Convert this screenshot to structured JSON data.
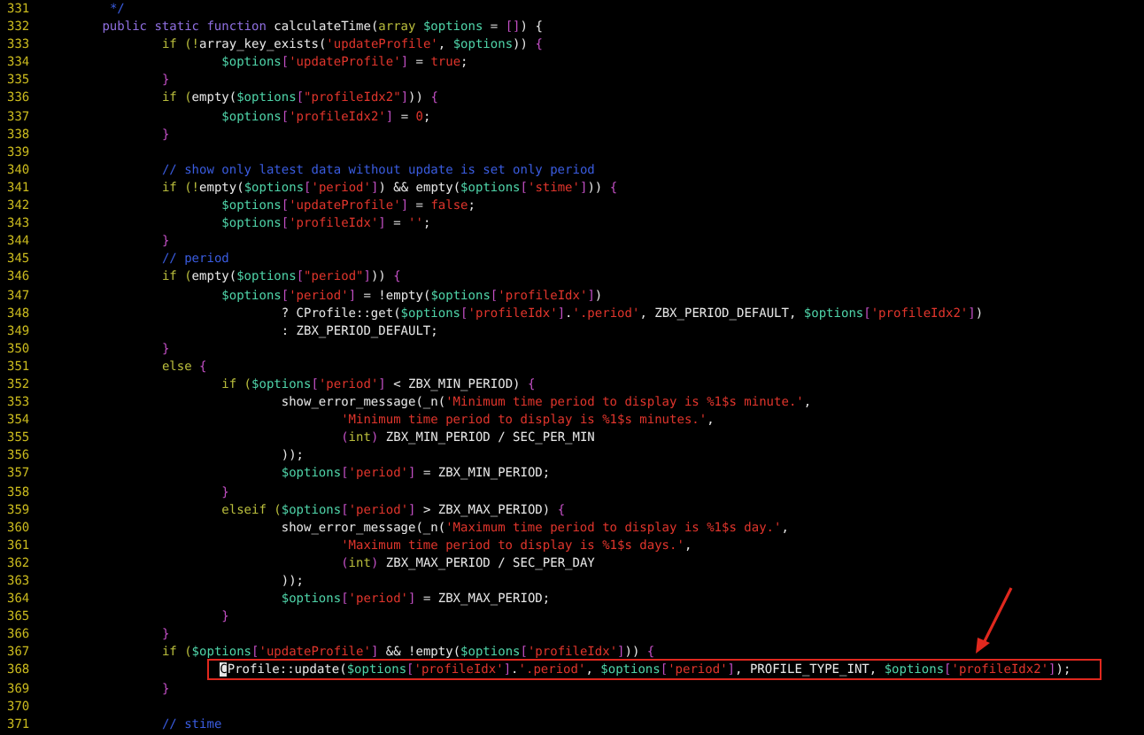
{
  "editor": {
    "lines": [
      {
        "number": "331",
        "boxed": false,
        "tokens": [
          {
            "kind": "comment",
            "text": "\t */"
          }
        ]
      },
      {
        "number": "332",
        "boxed": false,
        "tokens": [
          {
            "kind": "keyword",
            "text": "\tpublic static function"
          },
          {
            "kind": "plain",
            "text": " calculateTime("
          },
          {
            "kind": "control",
            "text": "array"
          },
          {
            "kind": "variable",
            "text": " $options"
          },
          {
            "kind": "plain",
            "text": " = "
          },
          {
            "kind": "bracket",
            "text": "[]"
          },
          {
            "kind": "plain",
            "text": ") {"
          }
        ]
      },
      {
        "number": "333",
        "boxed": false,
        "tokens": [
          {
            "kind": "control",
            "text": "\t\tif (!"
          },
          {
            "kind": "plain",
            "text": "array_key_exists("
          },
          {
            "kind": "string",
            "text": "'updateProfile'"
          },
          {
            "kind": "plain",
            "text": ", "
          },
          {
            "kind": "variable",
            "text": "$options"
          },
          {
            "kind": "plain",
            "text": ")) "
          },
          {
            "kind": "bracket",
            "text": "{"
          }
        ]
      },
      {
        "number": "334",
        "boxed": false,
        "tokens": [
          {
            "kind": "variable",
            "text": "\t\t\t$options"
          },
          {
            "kind": "bracket",
            "text": "["
          },
          {
            "kind": "string",
            "text": "'updateProfile'"
          },
          {
            "kind": "bracket",
            "text": "]"
          },
          {
            "kind": "plain",
            "text": " = "
          },
          {
            "kind": "string",
            "text": "true"
          },
          {
            "kind": "plain",
            "text": ";"
          }
        ]
      },
      {
        "number": "335",
        "boxed": false,
        "tokens": [
          {
            "kind": "bracket",
            "text": "\t\t}"
          }
        ]
      },
      {
        "number": "336",
        "boxed": false,
        "tokens": [
          {
            "kind": "control",
            "text": "\t\tif ("
          },
          {
            "kind": "plain",
            "text": "empty("
          },
          {
            "kind": "variable",
            "text": "$options"
          },
          {
            "kind": "bracket",
            "text": "["
          },
          {
            "kind": "string",
            "text": "\"profileIdx2\""
          },
          {
            "kind": "bracket",
            "text": "]"
          },
          {
            "kind": "plain",
            "text": ")) "
          },
          {
            "kind": "bracket",
            "text": "{"
          }
        ]
      },
      {
        "number": "337",
        "boxed": false,
        "tokens": [
          {
            "kind": "variable",
            "text": "\t\t\t$options"
          },
          {
            "kind": "bracket",
            "text": "["
          },
          {
            "kind": "string",
            "text": "'profileIdx2'"
          },
          {
            "kind": "bracket",
            "text": "]"
          },
          {
            "kind": "plain",
            "text": " = "
          },
          {
            "kind": "string",
            "text": "0"
          },
          {
            "kind": "plain",
            "text": ";"
          }
        ]
      },
      {
        "number": "338",
        "boxed": false,
        "tokens": [
          {
            "kind": "bracket",
            "text": "\t\t}"
          }
        ]
      },
      {
        "number": "339",
        "boxed": false
      },
      {
        "number": "340",
        "boxed": false,
        "tokens": [
          {
            "kind": "comment",
            "text": "\t\t// show only latest data without update is set only period"
          }
        ]
      },
      {
        "number": "341",
        "boxed": false,
        "tokens": [
          {
            "kind": "control",
            "text": "\t\tif (!"
          },
          {
            "kind": "plain",
            "text": "empty("
          },
          {
            "kind": "variable",
            "text": "$options"
          },
          {
            "kind": "bracket",
            "text": "["
          },
          {
            "kind": "string",
            "text": "'period'"
          },
          {
            "kind": "bracket",
            "text": "]"
          },
          {
            "kind": "plain",
            "text": ") && empty("
          },
          {
            "kind": "variable",
            "text": "$options"
          },
          {
            "kind": "bracket",
            "text": "["
          },
          {
            "kind": "string",
            "text": "'stime'"
          },
          {
            "kind": "bracket",
            "text": "]"
          },
          {
            "kind": "plain",
            "text": ")) "
          },
          {
            "kind": "bracket",
            "text": "{"
          }
        ]
      },
      {
        "number": "342",
        "boxed": false,
        "tokens": [
          {
            "kind": "variable",
            "text": "\t\t\t$options"
          },
          {
            "kind": "bracket",
            "text": "["
          },
          {
            "kind": "string",
            "text": "'updateProfile'"
          },
          {
            "kind": "bracket",
            "text": "]"
          },
          {
            "kind": "plain",
            "text": " = "
          },
          {
            "kind": "string",
            "text": "false"
          },
          {
            "kind": "plain",
            "text": ";"
          }
        ]
      },
      {
        "number": "343",
        "boxed": false,
        "tokens": [
          {
            "kind": "variable",
            "text": "\t\t\t$options"
          },
          {
            "kind": "bracket",
            "text": "["
          },
          {
            "kind": "string",
            "text": "'profileIdx'"
          },
          {
            "kind": "bracket",
            "text": "]"
          },
          {
            "kind": "plain",
            "text": " = "
          },
          {
            "kind": "string",
            "text": "''"
          },
          {
            "kind": "plain",
            "text": ";"
          }
        ]
      },
      {
        "number": "344",
        "boxed": false,
        "tokens": [
          {
            "kind": "bracket",
            "text": "\t\t}"
          }
        ]
      },
      {
        "number": "345",
        "boxed": false,
        "tokens": [
          {
            "kind": "comment",
            "text": "\t\t// period"
          }
        ]
      },
      {
        "number": "346",
        "boxed": false,
        "tokens": [
          {
            "kind": "control",
            "text": "\t\tif ("
          },
          {
            "kind": "plain",
            "text": "empty("
          },
          {
            "kind": "variable",
            "text": "$options"
          },
          {
            "kind": "bracket",
            "text": "["
          },
          {
            "kind": "string",
            "text": "\"period\""
          },
          {
            "kind": "bracket",
            "text": "]"
          },
          {
            "kind": "plain",
            "text": ")) "
          },
          {
            "kind": "bracket",
            "text": "{"
          }
        ]
      },
      {
        "number": "347",
        "boxed": false,
        "tokens": [
          {
            "kind": "variable",
            "text": "\t\t\t$options"
          },
          {
            "kind": "bracket",
            "text": "["
          },
          {
            "kind": "string",
            "text": "'period'"
          },
          {
            "kind": "bracket",
            "text": "]"
          },
          {
            "kind": "plain",
            "text": " = !empty("
          },
          {
            "kind": "variable",
            "text": "$options"
          },
          {
            "kind": "bracket",
            "text": "["
          },
          {
            "kind": "string",
            "text": "'profileIdx'"
          },
          {
            "kind": "bracket",
            "text": "]"
          },
          {
            "kind": "plain",
            "text": ")"
          }
        ]
      },
      {
        "number": "348",
        "boxed": false,
        "tokens": [
          {
            "kind": "plain",
            "text": "\t\t\t\t? CProfile::get("
          },
          {
            "kind": "variable",
            "text": "$options"
          },
          {
            "kind": "bracket",
            "text": "["
          },
          {
            "kind": "string",
            "text": "'profileIdx'"
          },
          {
            "kind": "bracket",
            "text": "]"
          },
          {
            "kind": "plain",
            "text": "."
          },
          {
            "kind": "string",
            "text": "'.period'"
          },
          {
            "kind": "plain",
            "text": ", ZBX_PERIOD_DEFAULT, "
          },
          {
            "kind": "variable",
            "text": "$options"
          },
          {
            "kind": "bracket",
            "text": "["
          },
          {
            "kind": "string",
            "text": "'profileIdx2'"
          },
          {
            "kind": "bracket",
            "text": "]"
          },
          {
            "kind": "plain",
            "text": ")"
          }
        ]
      },
      {
        "number": "349",
        "boxed": false,
        "tokens": [
          {
            "kind": "plain",
            "text": "\t\t\t\t: ZBX_PERIOD_DEFAULT;"
          }
        ]
      },
      {
        "number": "350",
        "boxed": false,
        "tokens": [
          {
            "kind": "bracket",
            "text": "\t\t}"
          }
        ]
      },
      {
        "number": "351",
        "boxed": false,
        "tokens": [
          {
            "kind": "control",
            "text": "\t\telse "
          },
          {
            "kind": "bracket",
            "text": "{"
          }
        ]
      },
      {
        "number": "352",
        "boxed": false,
        "tokens": [
          {
            "kind": "control",
            "text": "\t\t\tif ("
          },
          {
            "kind": "variable",
            "text": "$options"
          },
          {
            "kind": "bracket",
            "text": "["
          },
          {
            "kind": "string",
            "text": "'period'"
          },
          {
            "kind": "bracket",
            "text": "]"
          },
          {
            "kind": "plain",
            "text": " < ZBX_MIN_PERIOD) "
          },
          {
            "kind": "bracket",
            "text": "{"
          }
        ]
      },
      {
        "number": "353",
        "boxed": false,
        "tokens": [
          {
            "kind": "plain",
            "text": "\t\t\t\tshow_error_message(_n("
          },
          {
            "kind": "string",
            "text": "'Minimum time period to display is %1$s minute.'"
          },
          {
            "kind": "plain",
            "text": ","
          }
        ]
      },
      {
        "number": "354",
        "boxed": false,
        "tokens": [
          {
            "kind": "string",
            "text": "\t\t\t\t\t'Minimum time period to display is %1$s minutes.'"
          },
          {
            "kind": "plain",
            "text": ","
          }
        ]
      },
      {
        "number": "355",
        "boxed": false,
        "tokens": [
          {
            "kind": "bracket",
            "text": "\t\t\t\t\t("
          },
          {
            "kind": "control",
            "text": "int"
          },
          {
            "kind": "bracket",
            "text": ")"
          },
          {
            "kind": "plain",
            "text": " ZBX_MIN_PERIOD / SEC_PER_MIN"
          }
        ]
      },
      {
        "number": "356",
        "boxed": false,
        "tokens": [
          {
            "kind": "plain",
            "text": "\t\t\t\t));"
          }
        ]
      },
      {
        "number": "357",
        "boxed": false,
        "tokens": [
          {
            "kind": "variable",
            "text": "\t\t\t\t$options"
          },
          {
            "kind": "bracket",
            "text": "["
          },
          {
            "kind": "string",
            "text": "'period'"
          },
          {
            "kind": "bracket",
            "text": "]"
          },
          {
            "kind": "plain",
            "text": " = ZBX_MIN_PERIOD;"
          }
        ]
      },
      {
        "number": "358",
        "boxed": false,
        "tokens": [
          {
            "kind": "bracket",
            "text": "\t\t\t}"
          }
        ]
      },
      {
        "number": "359",
        "boxed": false,
        "tokens": [
          {
            "kind": "control",
            "text": "\t\t\telseif ("
          },
          {
            "kind": "variable",
            "text": "$options"
          },
          {
            "kind": "bracket",
            "text": "["
          },
          {
            "kind": "string",
            "text": "'period'"
          },
          {
            "kind": "bracket",
            "text": "]"
          },
          {
            "kind": "plain",
            "text": " > ZBX_MAX_PERIOD) "
          },
          {
            "kind": "bracket",
            "text": "{"
          }
        ]
      },
      {
        "number": "360",
        "boxed": false,
        "tokens": [
          {
            "kind": "plain",
            "text": "\t\t\t\tshow_error_message(_n("
          },
          {
            "kind": "string",
            "text": "'Maximum time period to display is %1$s day.'"
          },
          {
            "kind": "plain",
            "text": ","
          }
        ]
      },
      {
        "number": "361",
        "boxed": false,
        "tokens": [
          {
            "kind": "string",
            "text": "\t\t\t\t\t'Maximum time period to display is %1$s days.'"
          },
          {
            "kind": "plain",
            "text": ","
          }
        ]
      },
      {
        "number": "362",
        "boxed": false,
        "tokens": [
          {
            "kind": "bracket",
            "text": "\t\t\t\t\t("
          },
          {
            "kind": "control",
            "text": "int"
          },
          {
            "kind": "bracket",
            "text": ")"
          },
          {
            "kind": "plain",
            "text": " ZBX_MAX_PERIOD / SEC_PER_DAY"
          }
        ]
      },
      {
        "number": "363",
        "boxed": false,
        "tokens": [
          {
            "kind": "plain",
            "text": "\t\t\t\t));"
          }
        ]
      },
      {
        "number": "364",
        "boxed": false,
        "tokens": [
          {
            "kind": "variable",
            "text": "\t\t\t\t$options"
          },
          {
            "kind": "bracket",
            "text": "["
          },
          {
            "kind": "string",
            "text": "'period'"
          },
          {
            "kind": "bracket",
            "text": "]"
          },
          {
            "kind": "plain",
            "text": " = ZBX_MAX_PERIOD;"
          }
        ]
      },
      {
        "number": "365",
        "boxed": false,
        "tokens": [
          {
            "kind": "bracket",
            "text": "\t\t\t}"
          }
        ]
      },
      {
        "number": "366",
        "boxed": false,
        "tokens": [
          {
            "kind": "bracket",
            "text": "\t\t}"
          }
        ]
      },
      {
        "number": "367",
        "boxed": false,
        "tokens": [
          {
            "kind": "control",
            "text": "\t\tif ("
          },
          {
            "kind": "variable",
            "text": "$options"
          },
          {
            "kind": "bracket",
            "text": "["
          },
          {
            "kind": "string",
            "text": "'updateProfile'"
          },
          {
            "kind": "bracket",
            "text": "]"
          },
          {
            "kind": "plain",
            "text": " && !empty("
          },
          {
            "kind": "variable",
            "text": "$options"
          },
          {
            "kind": "bracket",
            "text": "["
          },
          {
            "kind": "string",
            "text": "'profileIdx'"
          },
          {
            "kind": "bracket",
            "text": "]"
          },
          {
            "kind": "plain",
            "text": ")) "
          },
          {
            "kind": "bracket",
            "text": "{"
          }
        ]
      },
      {
        "number": "368",
        "boxed": true,
        "tokens": [
          {
            "kind": "cursor",
            "text": "\t\t\tC"
          },
          {
            "kind": "plain",
            "text": "Profile::update("
          },
          {
            "kind": "variable",
            "text": "$options"
          },
          {
            "kind": "bracket",
            "text": "["
          },
          {
            "kind": "string",
            "text": "'profileIdx'"
          },
          {
            "kind": "bracket",
            "text": "]"
          },
          {
            "kind": "plain",
            "text": "."
          },
          {
            "kind": "string",
            "text": "'.period'"
          },
          {
            "kind": "plain",
            "text": ", "
          },
          {
            "kind": "variable",
            "text": "$options"
          },
          {
            "kind": "bracket",
            "text": "["
          },
          {
            "kind": "string",
            "text": "'period'"
          },
          {
            "kind": "bracket",
            "text": "]"
          },
          {
            "kind": "plain",
            "text": ", PROFILE_TYPE_INT, "
          },
          {
            "kind": "variable",
            "text": "$options"
          },
          {
            "kind": "bracket",
            "text": "["
          },
          {
            "kind": "string",
            "text": "'profileIdx2'"
          },
          {
            "kind": "bracket",
            "text": "]"
          },
          {
            "kind": "plain",
            "text": ");"
          }
        ]
      },
      {
        "number": "369",
        "boxed": false,
        "tokens": [
          {
            "kind": "bracket",
            "text": "\t\t}"
          }
        ]
      },
      {
        "number": "370",
        "boxed": false
      },
      {
        "number": "371",
        "boxed": false,
        "tokens": [
          {
            "kind": "comment",
            "text": "\t\t// stime"
          }
        ]
      }
    ]
  }
}
